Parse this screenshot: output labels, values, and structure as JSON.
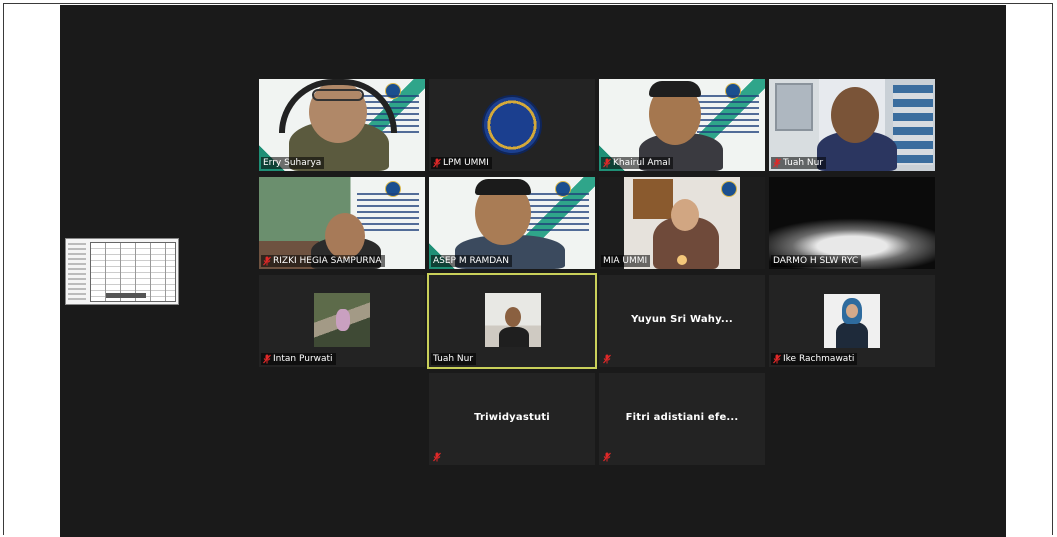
{
  "meeting": {
    "participants": [
      {
        "name": "Erry Suharya",
        "muted": false,
        "type": "video-slide"
      },
      {
        "name": "LPM UMMI",
        "muted": true,
        "type": "logo"
      },
      {
        "name": "Khairul Amal",
        "muted": true,
        "type": "video-slide"
      },
      {
        "name": "Tuah Nur",
        "muted": true,
        "type": "video-room"
      },
      {
        "name": "RIZKI HEGIA SAMPURNA",
        "muted": true,
        "type": "video-slide"
      },
      {
        "name": "ASEP M RAMDAN",
        "muted": false,
        "type": "video-slide"
      },
      {
        "name": "MIA UMMI",
        "muted": false,
        "type": "video-room"
      },
      {
        "name": "DARMO H SLW RYC",
        "muted": false,
        "type": "video-dark"
      },
      {
        "name": "Intan Purwati",
        "muted": true,
        "type": "photo"
      },
      {
        "name": "Tuah Nur",
        "muted": false,
        "type": "photo",
        "active_speaker": true
      },
      {
        "name": "Yuyun Sri Wahy...",
        "muted": true,
        "type": "name-only"
      },
      {
        "name": "Ike Rachmawati",
        "muted": true,
        "type": "photo"
      },
      {
        "name": "Triwidyastuti",
        "muted": true,
        "type": "name-only"
      },
      {
        "name": "Fitri adistiani efe...",
        "muted": true,
        "type": "name-only"
      }
    ]
  },
  "colors": {
    "stage_bg": "#1a1a1a",
    "tile_bg": "#232323",
    "active_speaker_border": "#c9d05a",
    "muted_icon": "#e02828"
  },
  "icons": {
    "muted": "microphone-muted-icon"
  }
}
